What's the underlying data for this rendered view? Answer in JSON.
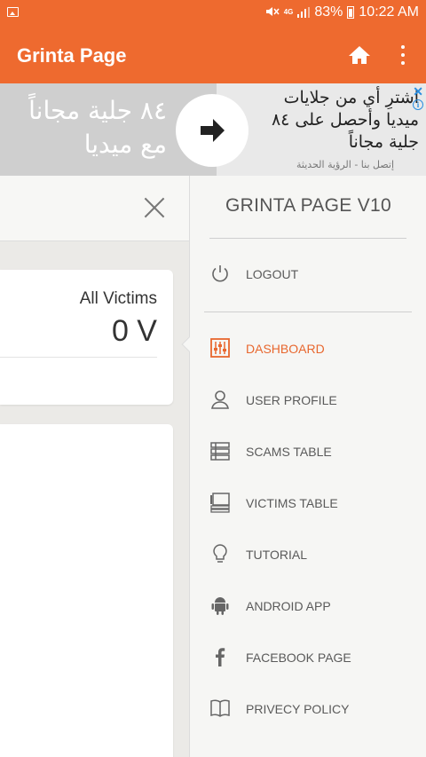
{
  "status_bar": {
    "battery": "83%",
    "time": "10:22 AM",
    "network": "4G",
    "icons": [
      "image-icon",
      "mute-icon",
      "signal-icon",
      "battery-icon"
    ]
  },
  "app_bar": {
    "title": "Grinta Page",
    "background": "#ee6a2f",
    "icons": [
      "home-icon",
      "more-vert-icon"
    ]
  },
  "ad_banner": {
    "left_text_line1": "٨٤ جلية مجاناً",
    "left_text_line2": "مع ميديا",
    "right_text_line1": "اشترِ أي من جلايات",
    "right_text_line2": "ميديا وأحصل على ٨٤",
    "right_text_line3": "جلية مجاناً",
    "sponsor": "إتصل بنا - الرؤية الحديثة",
    "close_glyph": "✕",
    "info_glyph": "i",
    "icons": [
      "arrow-right-icon",
      "close-icon",
      "info-icon"
    ]
  },
  "main": {
    "card": {
      "label": "All Victims",
      "value": "0 V"
    },
    "icons": [
      "close-icon"
    ]
  },
  "drawer": {
    "title": "GRINTA PAGE V10",
    "accent": "#e8672e",
    "items": [
      {
        "label": "LOGOUT",
        "icon": "power-icon"
      },
      {
        "label": "DASHBOARD",
        "icon": "equalizer-icon",
        "active": true
      },
      {
        "label": "USER PROFILE",
        "icon": "user-icon"
      },
      {
        "label": "SCAMS TABLE",
        "icon": "table-icon"
      },
      {
        "label": "VICTIMS TABLE",
        "icon": "monitor-list-icon"
      },
      {
        "label": "TUTORIAL",
        "icon": "lightbulb-icon"
      },
      {
        "label": "ANDROID APP",
        "icon": "android-icon"
      },
      {
        "label": "FACEBOOK PAGE",
        "icon": "facebook-icon"
      },
      {
        "label": "PRIVECY POLICY",
        "icon": "book-icon"
      }
    ]
  }
}
